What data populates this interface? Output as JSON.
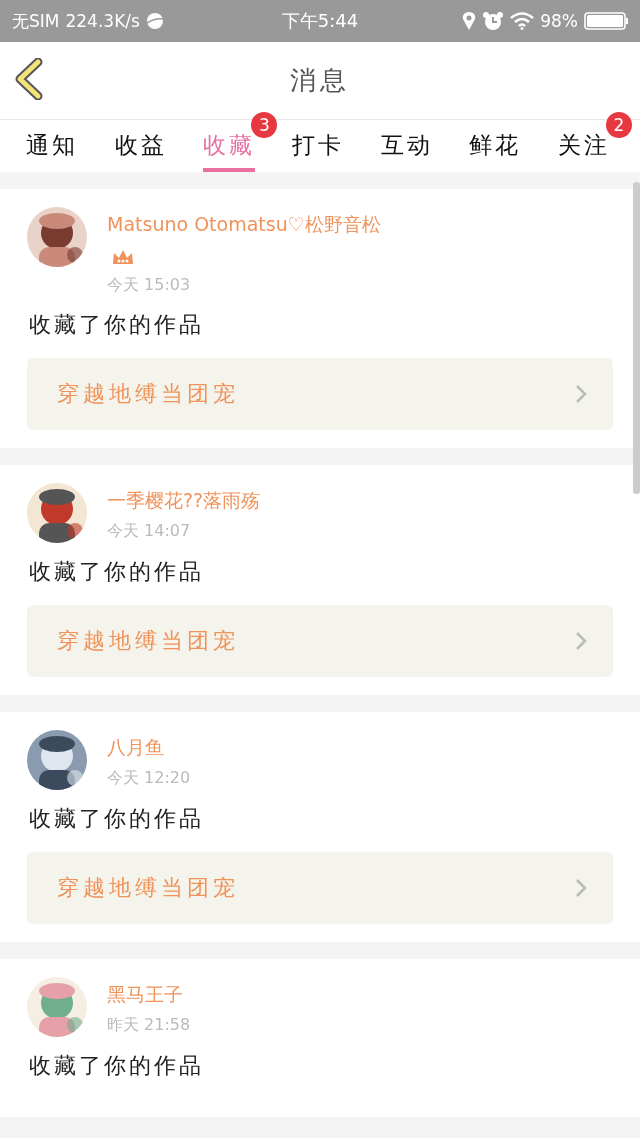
{
  "status_bar": {
    "carrier": "无SIM",
    "speed": "224.3K/s",
    "time": "下午5:44",
    "battery": "98%"
  },
  "header": {
    "title": "消息"
  },
  "tabs": [
    {
      "label": "通知",
      "selected": false
    },
    {
      "label": "收益",
      "selected": false
    },
    {
      "label": "收藏",
      "selected": true,
      "badge": "3"
    },
    {
      "label": "打卡",
      "selected": false
    },
    {
      "label": "互动",
      "selected": false
    },
    {
      "label": "鲜花",
      "selected": false
    },
    {
      "label": "关注",
      "selected": false,
      "badge": "2"
    }
  ],
  "messages": [
    {
      "name": "Matsuno Otomatsu♡松野音松",
      "crown": true,
      "time": "今天 15:03",
      "action": "收藏了你的作品",
      "work": "穿越地缚当团宠"
    },
    {
      "name": "一季樱花??落雨殇",
      "crown": false,
      "time": "今天 14:07",
      "action": "收藏了你的作品",
      "work": "穿越地缚当团宠"
    },
    {
      "name": "八月鱼",
      "crown": false,
      "time": "今天 12:20",
      "action": "收藏了你的作品",
      "work": "穿越地缚当团宠"
    },
    {
      "name": "黑马王子",
      "crown": false,
      "time": "昨天 21:58",
      "action": "收藏了你的作品"
    }
  ]
}
